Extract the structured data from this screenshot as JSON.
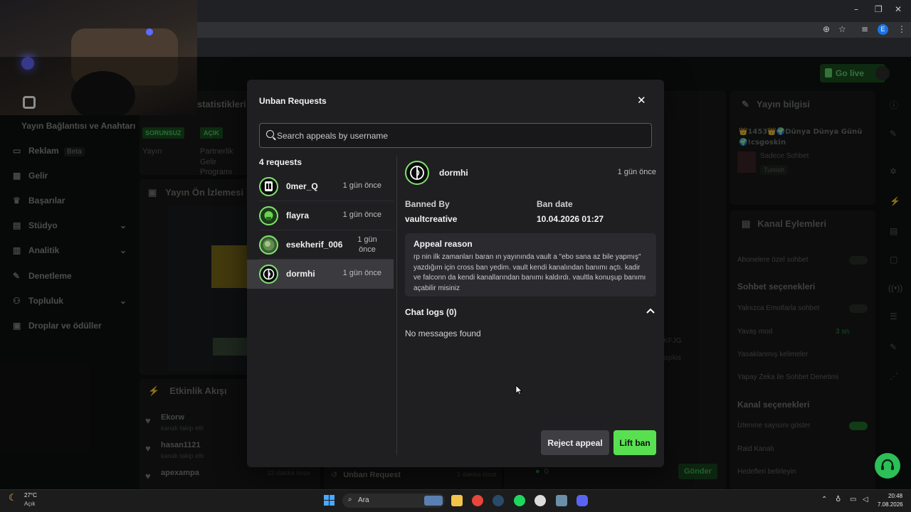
{
  "browser": {
    "window_controls": {
      "minimize": "–",
      "maximize": "❐",
      "close": "✕"
    },
    "extension_badge": "E"
  },
  "app": {
    "go_live": "Go live",
    "sidebar": {
      "stream_link": "Yayın Bağlantısı ve Anahtarı",
      "items": [
        {
          "label": "Reklam",
          "badge": "Beta",
          "icon": "megaphone-icon"
        },
        {
          "label": "Gelir",
          "icon": "revenue-icon"
        },
        {
          "label": "Başarılar",
          "icon": "trophy-icon"
        },
        {
          "label": "Stüdyo",
          "icon": "studio-icon"
        },
        {
          "label": "Analitik",
          "icon": "analytics-icon"
        },
        {
          "label": "Denetleme",
          "icon": "wrench-icon"
        },
        {
          "label": "Topluluk",
          "icon": "community-icon"
        },
        {
          "label": "Droplar ve ödüller",
          "icon": "gift-icon"
        }
      ]
    },
    "stats": {
      "title": "statistikleri",
      "badge_ok": "SORUNSUZ",
      "badge_open": "AÇIK",
      "col1": "Yayın",
      "col2_line1": "Partnerlik",
      "col2_line2": "Gelir",
      "col2_line3": "Programı"
    },
    "preview": {
      "title": "Yayın Ön İzlemesi"
    },
    "activity": {
      "title": "Etkinlik Akışı",
      "items": [
        {
          "user": "Ekorw",
          "desc": "kanalı takip etti"
        },
        {
          "user": "hasan1121",
          "desc": "kanalı takip etti"
        },
        {
          "user": "apexampa",
          "desc": "",
          "time": "23 dakika önce"
        }
      ]
    },
    "unban_feed": {
      "label": "Unban Request",
      "time": "1 dakika önce"
    },
    "chat_footer": {
      "count": "0",
      "send": "Gönder"
    },
    "chat_fragments": {
      "a": "KFJG",
      "b": "aşikis"
    },
    "stream_info": {
      "title": "Yayın bilgisi",
      "stream_title": "👑1453👑🌍Dünya Dünya Günü🌍!csgoskin",
      "chat_mode": "Sadece Sohbet",
      "language": "Turkish"
    },
    "channel_actions": {
      "title": "Kanal Eylemleri",
      "subs_only": "Abonelere özel sohbet",
      "chat_options": "Sohbet seçenekleri",
      "emote_only": "Yalnızca Emotlarla sohbet",
      "slow_mode": "Yavaş mod",
      "slow_mode_value": "3 sn.",
      "banned_words": "Yasaklanmış kelimeler",
      "ai_moderation": "Yapay Zeka ile Sohbet Denetimi",
      "channel_options": "Kanal seçenekleri",
      "show_viewers": "İzlenme sayısını göster",
      "raid": "Raid Kanalı",
      "goals": "Hedefleri belirleyin"
    }
  },
  "modal": {
    "title": "Unban Requests",
    "search_placeholder": "Search appeals by username",
    "request_count": "4 requests",
    "requests": [
      {
        "username": "0mer_Q",
        "time": "1 gün önce"
      },
      {
        "username": "flayra",
        "time": "1 gün önce"
      },
      {
        "username": "esekherif_006",
        "time": "1 gün önce"
      },
      {
        "username": "dormhi",
        "time": "1 gün önce"
      }
    ],
    "selected": {
      "username": "dormhi",
      "time": "1 gün önce",
      "banned_by_label": "Banned By",
      "banned_by": "vaultcreative",
      "ban_date_label": "Ban date",
      "ban_date": "10.04.2026 01:27",
      "appeal_reason_label": "Appeal reason",
      "appeal_reason": "rp nin ilk zamanları baran ın yayınında vault a \"ebo sana az bile yapmış\" yazdığım için cross ban yedim. vault kendi kanalından banımı açtı. kadir ve falconn da kendi kanallarından banımı kaldırdı. vaultla konuşup banımı açabilir misiniz",
      "chat_logs_label": "Chat logs (0)",
      "no_messages": "No messages found"
    },
    "reject_label": "Reject appeal",
    "lift_label": "Lift ban"
  },
  "taskbar": {
    "weather_temp": "27°C",
    "weather_desc": "Açık",
    "search": "Ara",
    "time": "20:48",
    "date": "7.08.2026"
  },
  "colors": {
    "accent": "#59e051",
    "modal_bg": "#1f1f22",
    "app_bg": "#0e100f"
  }
}
